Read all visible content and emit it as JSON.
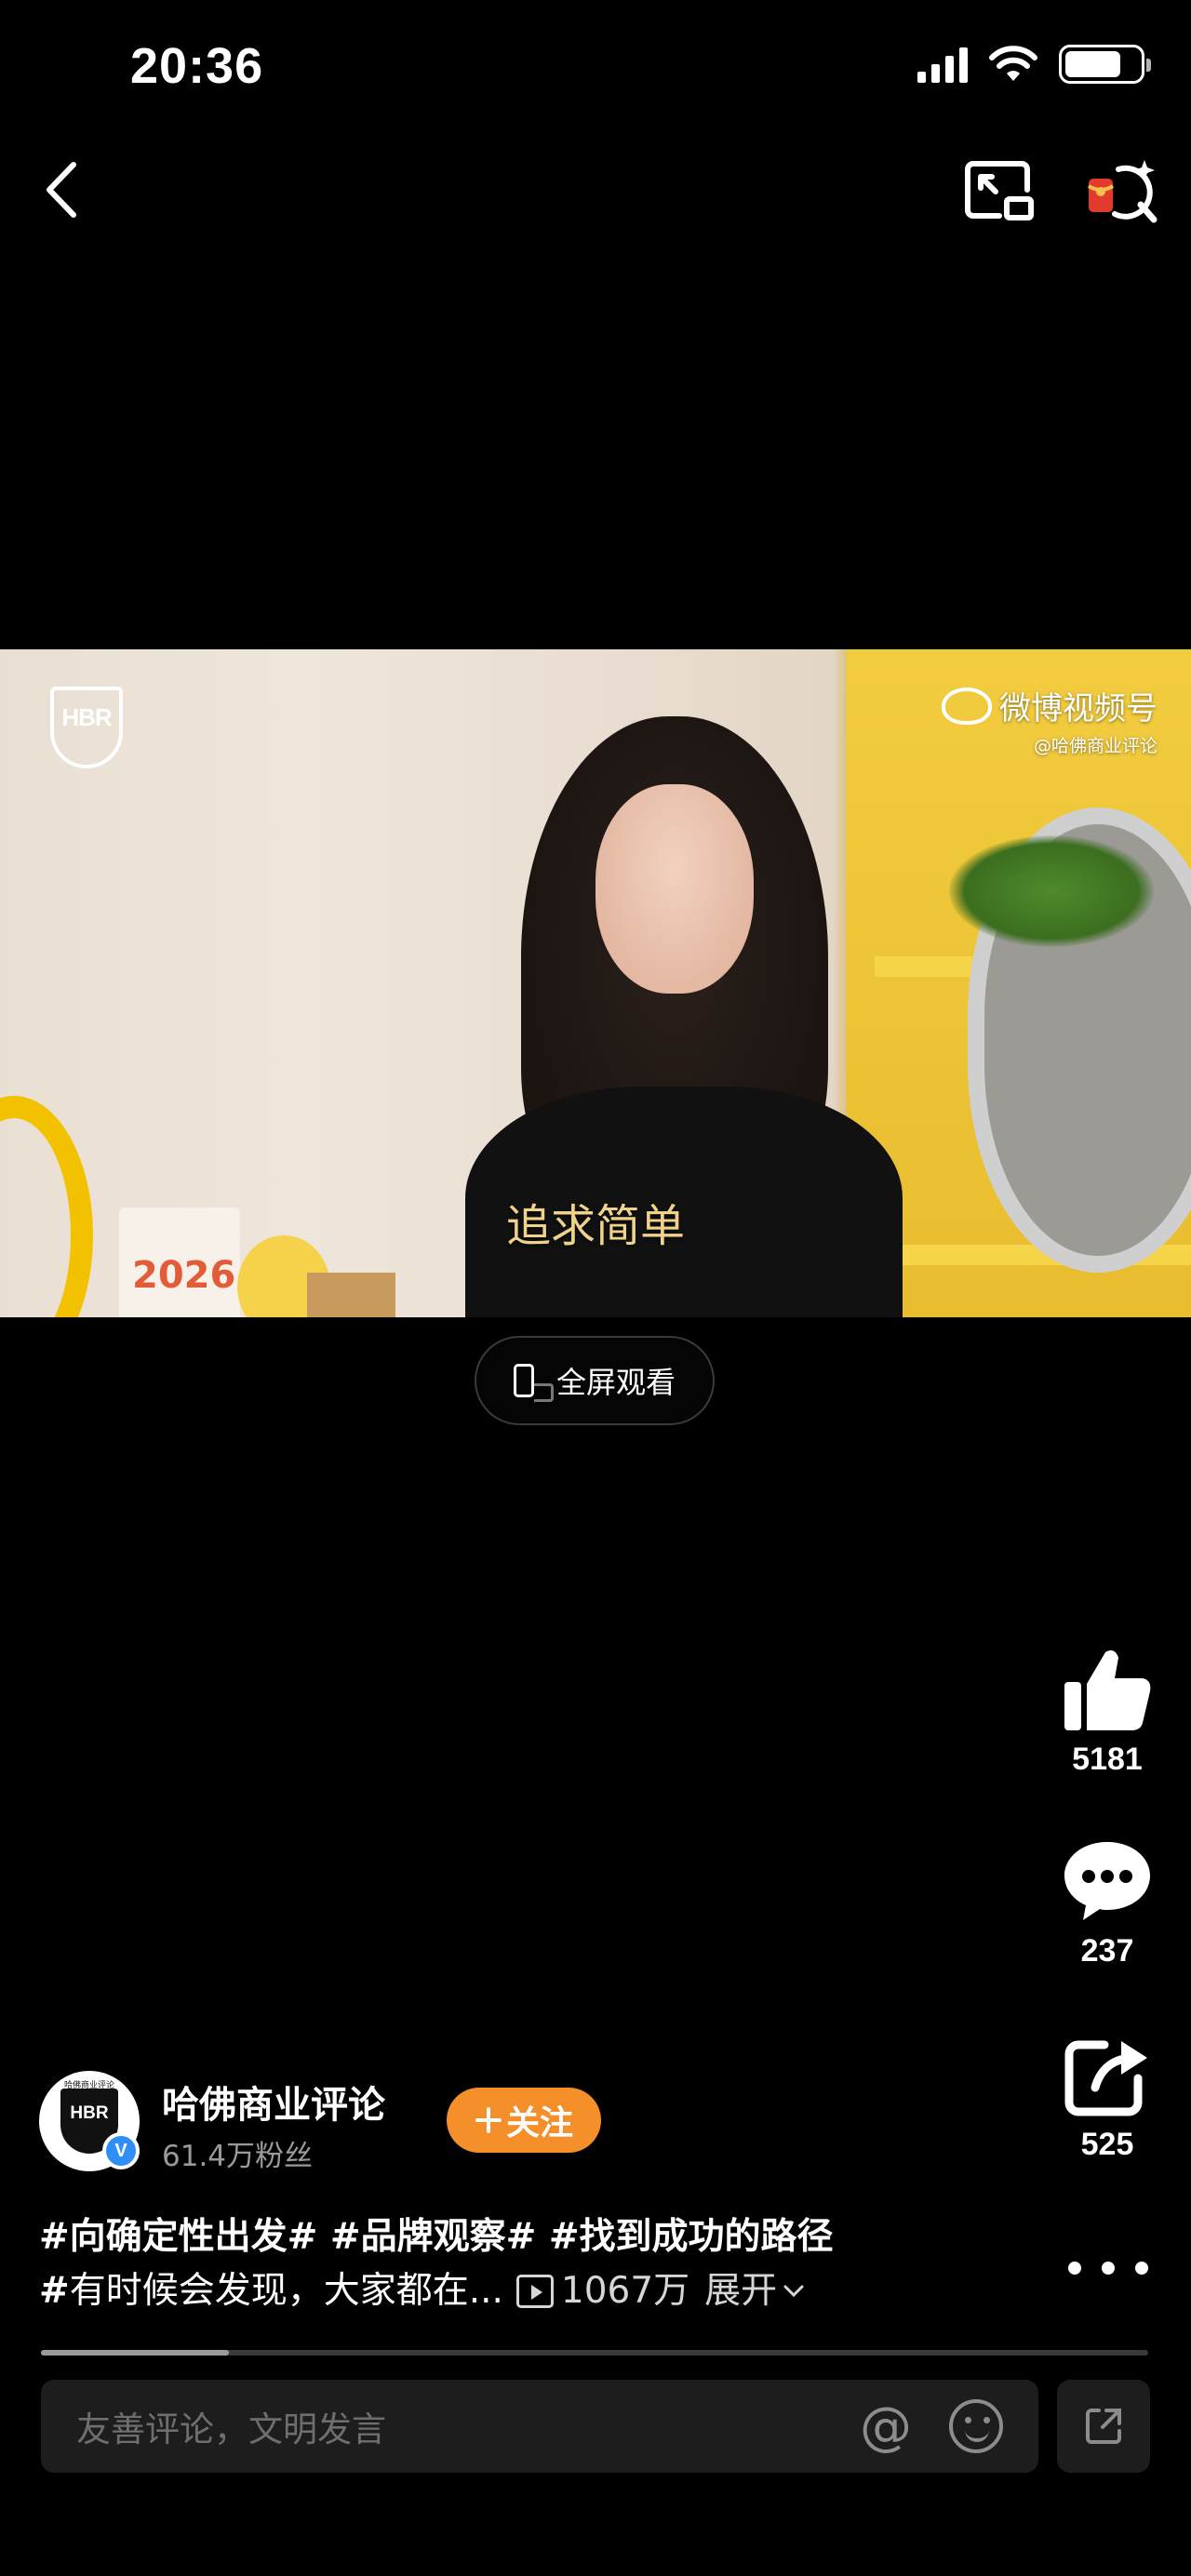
{
  "status_bar": {
    "time": "20:36",
    "signal_icon": "cellular-signal-icon",
    "wifi_icon": "wifi-icon",
    "battery_icon": "battery-icon",
    "battery_level": 0.75
  },
  "nav": {
    "back_icon": "chevron-left-icon",
    "pip_icon": "picture-in-picture-icon",
    "search_icon": "ai-search-icon"
  },
  "video": {
    "logo_text": "HBR",
    "watermark_main": "微博视频号",
    "watermark_sub": "@哈佛商业评论",
    "subtitle": "追求简单",
    "calendar_text": "2026"
  },
  "fullscreen": {
    "label": "全屏观看"
  },
  "actions": {
    "like_count": "5181",
    "comment_count": "237",
    "share_count": "525"
  },
  "author": {
    "name": "哈佛商业评论",
    "fans": "61.4万粉丝",
    "avatar_text": "HBR",
    "avatar_top_text": "哈佛商业评论",
    "verified_mark": "V",
    "follow_label": "关注"
  },
  "caption": {
    "line1": "#向确定性出发# #品牌观察# #找到成功的路径",
    "line2_hash": "#",
    "line2_text": " 有时候会发现，大家都在...",
    "views": "1067万",
    "expand": "展开"
  },
  "progress": 0.17,
  "comment_input": {
    "placeholder": "友善评论，文明发言",
    "at_symbol": "@"
  },
  "colors": {
    "accent_follow": "#F48F2A",
    "verified": "#2F8FF5",
    "subtitle": "#F0D28A"
  }
}
